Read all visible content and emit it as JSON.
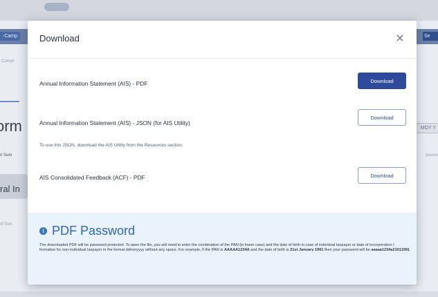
{
  "background": {
    "left_tab": "-Camp",
    "right_tab": "Se",
    "breadcrumb": "Compli",
    "heading": "orm",
    "subtitle": "n Sum",
    "section_title": "ral In",
    "section_sub": "of Sun",
    "right_select": "MOY Y",
    "right_note": "(ounce"
  },
  "modal": {
    "title": "Download",
    "close_icon": "close-icon",
    "rows": [
      {
        "label": "Annual Information Statement (AIS) - PDF",
        "button": "Download",
        "style": "primary"
      },
      {
        "label": "Annual Information Statement (AIS) - JSON (for AIS Utility)",
        "button": "Download",
        "style": "outline",
        "note": "To use this JSON, download the AIS Utility from the Resources section."
      },
      {
        "label": "AIS Consolidated Feedback (ACF) - PDF",
        "button": "Download",
        "style": "outline"
      }
    ],
    "password": {
      "icon": "info-icon",
      "title": "PDF Password",
      "text_intro": "The downloaded PDF will be password protected. To open the file, you will need to enter the combination of the PAN (in lower case) and the date of birth in case of individual taxpayer or date of incorporation / formation for non-individual taxpayer in the format ddmmyyyy without any space. For example, if the PAN is ",
      "example_pan": "AAAAA1234A",
      "text_mid": " and the date of birth is ",
      "example_dob": "21st January 1991",
      "text_end": " then your password will be ",
      "example_password": "aaaaa1234a21011991"
    }
  },
  "colors": {
    "primary": "#2f4a9b",
    "password_title": "#2e67b8",
    "password_bg": "#eaf2fc"
  }
}
